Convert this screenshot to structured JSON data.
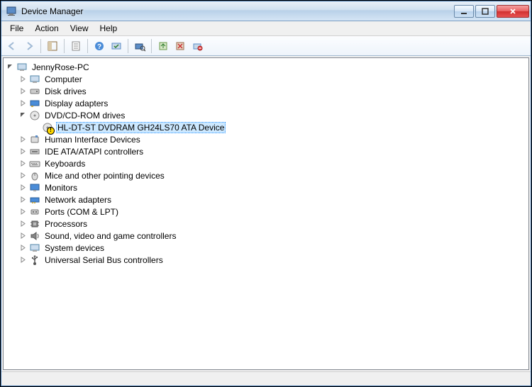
{
  "window": {
    "title": "Device Manager"
  },
  "menu": {
    "file": "File",
    "action": "Action",
    "view": "View",
    "help": "Help"
  },
  "tree": {
    "root": "JennyRose-PC",
    "computer": "Computer",
    "disk_drives": "Disk drives",
    "display_adapters": "Display adapters",
    "dvd_cdrom": "DVD/CD-ROM drives",
    "dvd_device": "HL-DT-ST DVDRAM GH24LS70 ATA Device",
    "hid": "Human Interface Devices",
    "ide": "IDE ATA/ATAPI controllers",
    "keyboards": "Keyboards",
    "mice": "Mice and other pointing devices",
    "monitors": "Monitors",
    "network": "Network adapters",
    "ports": "Ports (COM & LPT)",
    "processors": "Processors",
    "sound": "Sound, video and game controllers",
    "system_devices": "System devices",
    "usb": "Universal Serial Bus controllers"
  }
}
